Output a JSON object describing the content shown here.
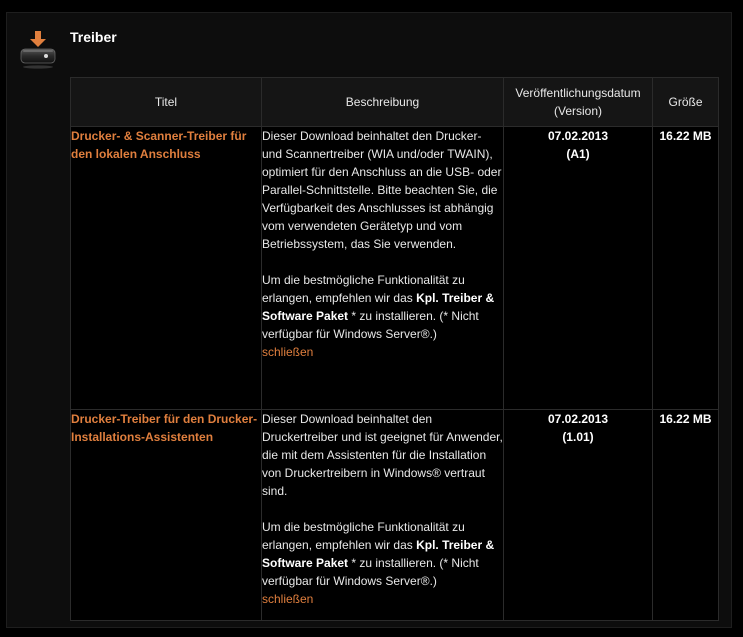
{
  "section": {
    "title": "Treiber",
    "icon": "hard-drive-download-icon"
  },
  "columns": {
    "title": "Titel",
    "description": "Beschreibung",
    "date_line1": "Veröffentlichungsdatum",
    "date_line2": "(Version)",
    "size": "Größe"
  },
  "rows": [
    {
      "title": "Drucker- & Scanner-Treiber für den lokalen Anschluss",
      "description": "Dieser Download beinhaltet den Drucker- und Scannertreiber (WIA und/oder TWAIN), optimiert für den Anschluss an die USB- oder Parallel-Schnittstelle. Bitte beachten Sie, die Verfügbarkeit des Anschlusses ist abhängig vom verwendeten Gerätetyp und vom Betriebssystem, das Sie verwenden.",
      "note_prefix": "Um die bestmögliche Funktionalität zu erlangen, empfehlen wir das ",
      "note_bold": "Kpl. Treiber & Software Paket",
      "note_suffix": " * zu installieren. (* Nicht verfügbar für Windows Server®.)",
      "close_link": "schließen",
      "date": "07.02.2013",
      "version": "(A1)",
      "size": "16.22 MB"
    },
    {
      "title": "Drucker-Treiber für den Drucker-Installations-Assistenten",
      "description": "Dieser Download beinhaltet den Druckertreiber und ist geeignet für Anwender, die mit dem Assistenten für die Installation von Druckertreibern in Windows® vertraut sind.",
      "note_prefix": "Um die bestmögliche Funktionalität zu erlangen, empfehlen wir das ",
      "note_bold": "Kpl. Treiber & Software Paket",
      "note_suffix": " * zu installieren. (* Nicht verfügbar für Windows Server®.)",
      "close_link": "schließen",
      "date": "07.02.2013",
      "version": "(1.01)",
      "size": "16.22 MB"
    }
  ],
  "colors": {
    "accent": "#e07f3e",
    "background": "#000000",
    "header_bg": "#151515",
    "border": "#2b2b2b"
  }
}
